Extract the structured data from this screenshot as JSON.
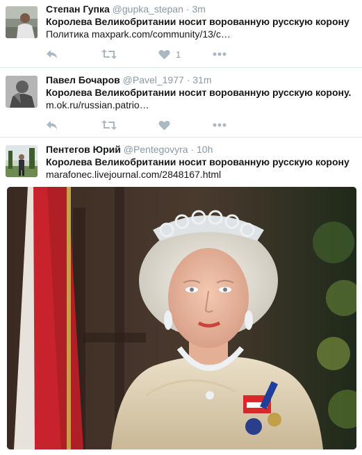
{
  "tweets": [
    {
      "name": "Степан Гупка",
      "handle": "@gupka_stepan",
      "separator": "·",
      "time": "3m",
      "text": "Королева Великобритании носит ворованную русскую корону",
      "link_prefix": "Политика",
      "link_url": "maxpark.com/community/13/c…",
      "like_count": "1"
    },
    {
      "name": "Павел Бочаров",
      "handle": "@Pavel_1977",
      "separator": "·",
      "time": "31m",
      "text": "Королева Великобритании носит ворованную русскую корону.",
      "link_url": "m.ok.ru/russian.patrio…",
      "like_count": ""
    },
    {
      "name": "Пентегов Юрий",
      "handle": "@Pentegovyra",
      "separator": "·",
      "time": "10h",
      "text": "Королева Великобритании носит ворованную русскую корону",
      "link_url": "marafonec.livejournal.com/2848167.html"
    }
  ],
  "icons": {
    "reply": "reply-icon",
    "retweet": "retweet-icon",
    "like": "heart-icon",
    "more": "more-icon"
  },
  "colors": {
    "action_icon": "#aab8c2",
    "divider": "#e1e8ed",
    "secondary_text": "#8899a6"
  }
}
